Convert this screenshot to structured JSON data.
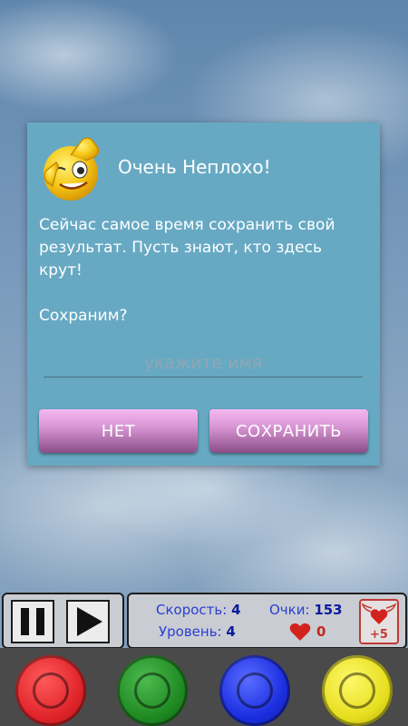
{
  "dialog": {
    "title": "Очень Неплохо!",
    "message": "Сейчас самое время сохранить свой результат. Пусть знают, кто здесь крут!\n\nСохраним?",
    "name_placeholder": "укажите имя",
    "name_value": "",
    "no_label": "НЕТ",
    "save_label": "СОХРАНИТЬ",
    "icon": "winking-emoji-icon"
  },
  "controls": {
    "pause_icon": "pause-icon",
    "play_icon": "play-icon"
  },
  "stats": {
    "speed_label": "Скорость:",
    "speed_value": "4",
    "score_label": "Очки:",
    "score_value": "153",
    "level_label": "Уровень:",
    "level_value": "4",
    "lives_icon": "heart-icon",
    "lives_value": "0",
    "bonus_label": "+5",
    "bonus_icon": "winged-heart-icon"
  },
  "color_buttons": [
    {
      "name": "red",
      "color": "#e0242a"
    },
    {
      "name": "green",
      "color": "#1f8a22"
    },
    {
      "name": "blue",
      "color": "#1b2ee0"
    },
    {
      "name": "yellow",
      "color": "#e6df1f"
    }
  ],
  "colors": {
    "dialog_bg": "#67a9c3",
    "button_pink": "#d896d4",
    "stat_text": "#2a3fd6"
  }
}
